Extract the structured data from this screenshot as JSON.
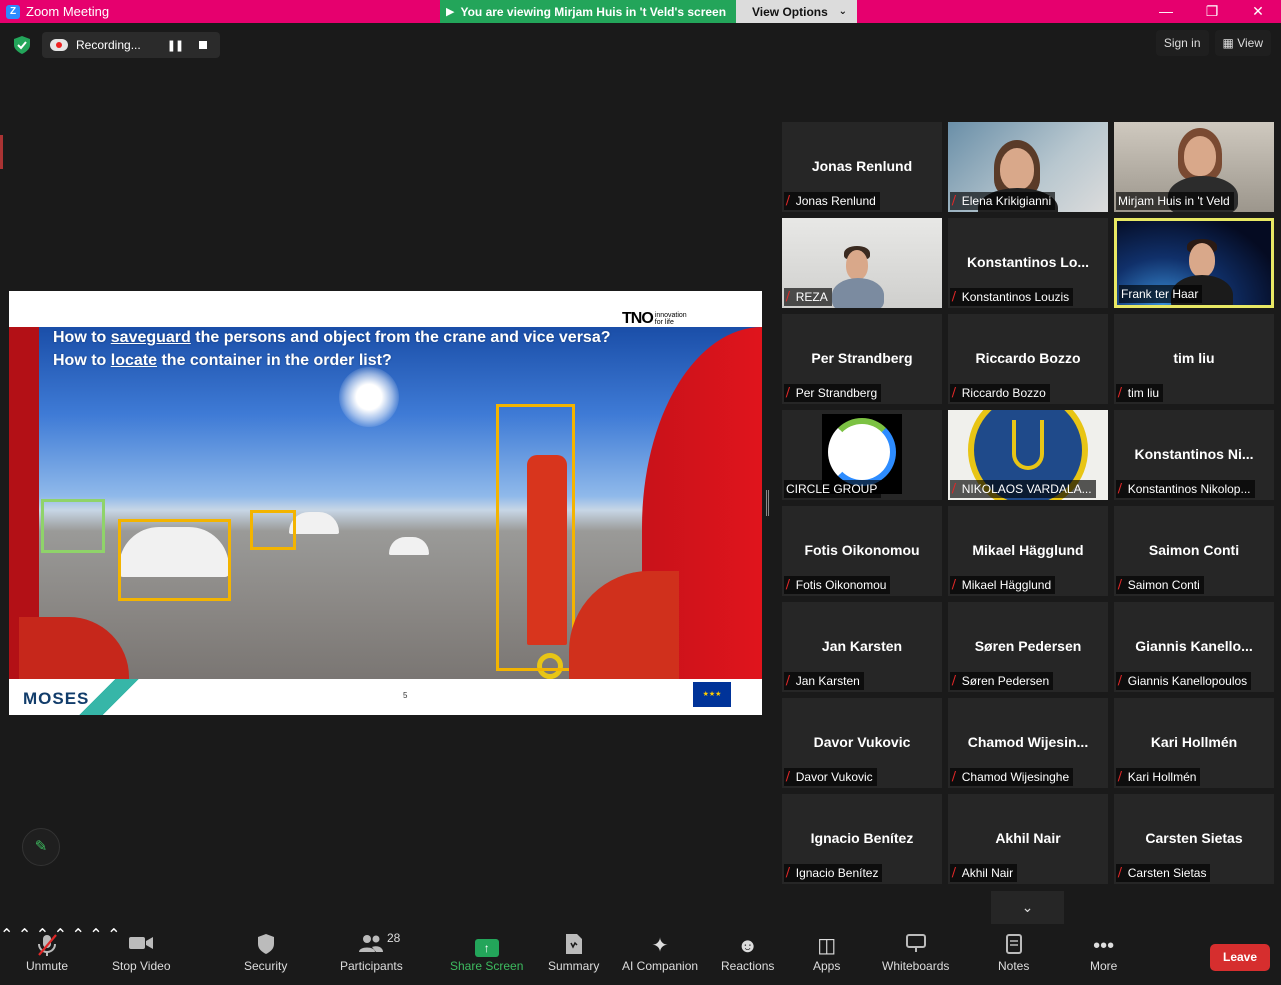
{
  "titlebar": {
    "app_title": "Zoom Meeting",
    "viewing_banner": "You are viewing Mirjam Huis in 't Veld's screen",
    "view_options": "View Options"
  },
  "topbar": {
    "recording_label": "Recording...",
    "sign_in": "Sign in",
    "view": "View"
  },
  "slide": {
    "question_1_pre": "How to ",
    "question_1_link": "saveguard",
    "question_1_post": " the persons and object from the crane and vice versa?",
    "question_2_pre": "How to ",
    "question_2_link": "locate",
    "question_2_post": " the container in the order list?",
    "tno_logo": "TNO",
    "tno_tagline_1": "innovation",
    "tno_tagline_2": "for life",
    "moses_logo": "MOSES",
    "page_number": "5"
  },
  "participants": [
    {
      "tile_name": "Jonas Renlund",
      "label": "Jonas Renlund",
      "video": false
    },
    {
      "tile_name": "",
      "label": "Elena Krikigianni",
      "video": true
    },
    {
      "tile_name": "",
      "label": "Mirjam Huis in 't Veld",
      "video": true,
      "muted": false
    },
    {
      "tile_name": "",
      "label": "REZA",
      "video": true
    },
    {
      "tile_name": "Konstantinos Lo...",
      "label": "Konstantinos Louzis",
      "video": false
    },
    {
      "tile_name": "",
      "label": "Frank ter Haar",
      "video": true,
      "muted": false,
      "active": true
    },
    {
      "tile_name": "Per Strandberg",
      "label": "Per Strandberg",
      "video": false
    },
    {
      "tile_name": "Riccardo Bozzo",
      "label": "Riccardo Bozzo",
      "video": false
    },
    {
      "tile_name": "tim liu",
      "label": "tim liu",
      "video": false
    },
    {
      "tile_name": "",
      "label": "CIRCLE GROUP",
      "video": true,
      "muted": false
    },
    {
      "tile_name": "",
      "label": "NIKOLAOS VARDALA...",
      "video": true
    },
    {
      "tile_name": "Konstantinos Ni...",
      "label": "Konstantinos Nikolop...",
      "video": false
    },
    {
      "tile_name": "Fotis Oikonomou",
      "label": "Fotis Oikonomou",
      "video": false
    },
    {
      "tile_name": "Mikael Hägglund",
      "label": "Mikael Hägglund",
      "video": false
    },
    {
      "tile_name": "Saimon Conti",
      "label": "Saimon Conti",
      "video": false
    },
    {
      "tile_name": "Jan Karsten",
      "label": "Jan Karsten",
      "video": false
    },
    {
      "tile_name": "Søren Pedersen",
      "label": "Søren Pedersen",
      "video": false
    },
    {
      "tile_name": "Giannis  Kanello...",
      "label": "Giannis Kanellopoulos",
      "video": false
    },
    {
      "tile_name": "Davor Vukovic",
      "label": "Davor Vukovic",
      "video": false
    },
    {
      "tile_name": "Chamod  Wijesin...",
      "label": "Chamod Wijesinghe",
      "video": false
    },
    {
      "tile_name": "Kari Hollmén",
      "label": "Kari Hollmén",
      "video": false
    },
    {
      "tile_name": "Ignacio Benítez",
      "label": "Ignacio Benítez",
      "video": false
    },
    {
      "tile_name": "Akhil Nair",
      "label": "Akhil Nair",
      "video": false
    },
    {
      "tile_name": "Carsten Sietas",
      "label": "Carsten Sietas",
      "video": false
    }
  ],
  "toolbar": {
    "unmute": "Unmute",
    "stop_video": "Stop Video",
    "security": "Security",
    "participants": "Participants",
    "participant_count": "28",
    "share_screen": "Share Screen",
    "summary": "Summary",
    "ai_companion": "AI Companion",
    "reactions": "Reactions",
    "apps": "Apps",
    "whiteboards": "Whiteboards",
    "notes": "Notes",
    "more": "More",
    "leave": "Leave"
  }
}
